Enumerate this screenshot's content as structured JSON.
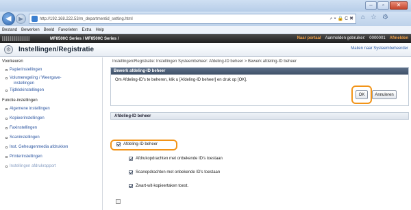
{
  "browser": {
    "url": "http://192.168.222.53/m_departmentid_setting.html",
    "addr_controls": "⌕ ▾ 🔒 C ✖",
    "menu": [
      "Bestand",
      "Bewerken",
      "Beeld",
      "Favorieten",
      "Extra",
      "Help"
    ]
  },
  "device": {
    "name": "MF8500C Series / MF8500C Series /",
    "portal": "Naar portaal",
    "login_label": "Aanmelden gebruiker:",
    "login_user": "0000001",
    "logout": "Afmelden"
  },
  "page": {
    "title": "Instellingen/Registratie",
    "mail_admin": "Mailen naar Systeembeheerder"
  },
  "sidebar": {
    "sections": [
      {
        "label": "Voorkeuren"
      },
      {
        "label": "Functie-instellingen"
      }
    ],
    "items": [
      {
        "label": "Papierinstellingen"
      },
      {
        "label": "Volumeregeling / Weergave-"
      },
      {
        "label": "instellingen"
      },
      {
        "label": "Tijdklokinstellingen"
      },
      {
        "label": "Algemene instellingen"
      },
      {
        "label": "Kopieerinstellingen"
      },
      {
        "label": "Faxinstellingen"
      },
      {
        "label": "Scaninstellingen"
      },
      {
        "label": "Inst. Geheugenmedia afdrukken"
      },
      {
        "label": "Printerinstellingen"
      },
      {
        "label": "Instellingen afdrukrapport"
      }
    ]
  },
  "main": {
    "breadcrumb": "Instellingen/Registratie: Instellingen Systeembeheer: Afdeling-ID beheer > Bewerk afdeling-ID beheer",
    "panel_title": "Bewerk afdeling-ID beheer",
    "panel_text": "Om Afdeling-ID's te beheren, klik u [Afdeling-ID beheer] en druk op [OK].",
    "ok_label": "OK",
    "cancel_label": "Annuleren",
    "section_title": "Afdeling-ID beheer",
    "checkbox_main": "Afdeling-ID beheer",
    "checkbox_print": "Afdrukopdrachten met onbekende ID's toestaan",
    "checkbox_scan": "Scanopdrachten met onbekende ID's toestaan",
    "checkbox_bw": "Zwart-wit-kopieertaken toest."
  },
  "colors": {
    "highlight": "#f29418",
    "link": "#2b55a0",
    "panel_head": "#3e5068"
  },
  "icons": {
    "back": "back-arrow-icon",
    "forward": "forward-arrow-icon",
    "home": "home-icon",
    "favorites": "star-icon",
    "settings": "gear-icon"
  }
}
